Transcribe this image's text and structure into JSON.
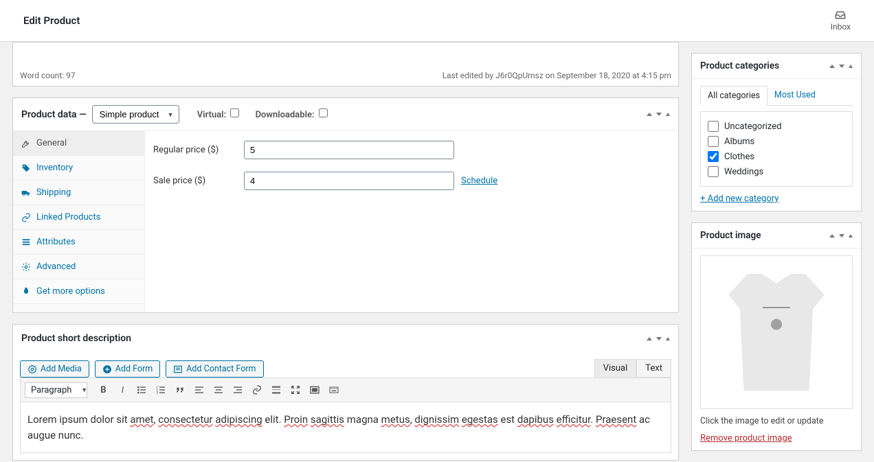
{
  "header": {
    "title": "Edit Product",
    "inbox_label": "Inbox"
  },
  "top_fragment": {
    "word_count": "Word count: 97",
    "last_edited": "Last edited by J6r0QpUmsz on September 18, 2020 at 4:15 pm"
  },
  "product_data": {
    "title": "Product data —",
    "type_select": "Simple product",
    "virtual_label": "Virtual:",
    "downloadable_label": "Downloadable:",
    "tabs": [
      {
        "label": "General"
      },
      {
        "label": "Inventory"
      },
      {
        "label": "Shipping"
      },
      {
        "label": "Linked Products"
      },
      {
        "label": "Attributes"
      },
      {
        "label": "Advanced"
      },
      {
        "label": "Get more options"
      }
    ],
    "regular_price_label": "Regular price ($)",
    "regular_price_value": "5",
    "sale_price_label": "Sale price ($)",
    "sale_price_value": "4",
    "schedule_label": "Schedule"
  },
  "short_desc": {
    "title": "Product short description",
    "add_media": "Add Media",
    "add_form": "Add Form",
    "add_contact_form": "Add Contact Form",
    "visual_tab": "Visual",
    "text_tab": "Text",
    "paragraph_label": "Paragraph",
    "content_plain": "Lorem ipsum dolor sit amet, consectetur adipiscing elit. Proin sagittis magna metus, dignissim egestas est dapibus efficitur. Praesent ac augue nunc."
  },
  "categories": {
    "title": "Product categories",
    "all_tab": "All categories",
    "most_used_tab": "Most Used",
    "items": [
      {
        "label": "Uncategorized",
        "checked": false
      },
      {
        "label": "Albums",
        "checked": false
      },
      {
        "label": "Clothes",
        "checked": true
      },
      {
        "label": "Weddings",
        "checked": false
      }
    ],
    "add_new": "+ Add new category"
  },
  "product_image": {
    "title": "Product image",
    "hint": "Click the image to edit or update",
    "remove": "Remove product image"
  }
}
